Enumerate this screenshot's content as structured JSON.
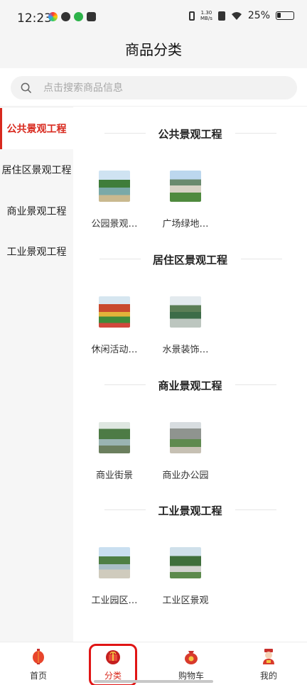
{
  "status_bar": {
    "time": "12:23",
    "net_speed_value": "1.30",
    "net_speed_unit": "MB/s",
    "battery": "25%"
  },
  "header": {
    "title": "商品分类"
  },
  "search": {
    "placeholder": "点击搜索商品信息"
  },
  "sidebar": {
    "items": [
      {
        "label": "公共景观工程",
        "active": true
      },
      {
        "label": "居住区景观工程",
        "active": false
      },
      {
        "label": "商业景观工程",
        "active": false
      },
      {
        "label": "工业景观工程",
        "active": false
      }
    ]
  },
  "sections": [
    {
      "title": "公共景观工程",
      "items": [
        {
          "label": "公园景观…"
        },
        {
          "label": "广场绿地…"
        }
      ]
    },
    {
      "title": "居住区景观工程",
      "items": [
        {
          "label": "休闲活动…"
        },
        {
          "label": "水景装饰…"
        }
      ]
    },
    {
      "title": "商业景观工程",
      "items": [
        {
          "label": "商业街景"
        },
        {
          "label": "商业办公园"
        }
      ]
    },
    {
      "title": "工业景观工程",
      "items": [
        {
          "label": "工业园区…"
        },
        {
          "label": "工业区景观"
        }
      ]
    }
  ],
  "bottom_nav": {
    "items": [
      {
        "label": "首页",
        "icon": "lantern-icon",
        "active": false
      },
      {
        "label": "分类",
        "icon": "gift-icon",
        "active": true
      },
      {
        "label": "购物车",
        "icon": "money-bag-icon",
        "active": false
      },
      {
        "label": "我的",
        "icon": "god-of-wealth-icon",
        "active": false
      }
    ]
  },
  "colors": {
    "accent": "#d8291e",
    "highlight_ring": "#e01515",
    "sidebar_bg": "#f6f6f6"
  }
}
